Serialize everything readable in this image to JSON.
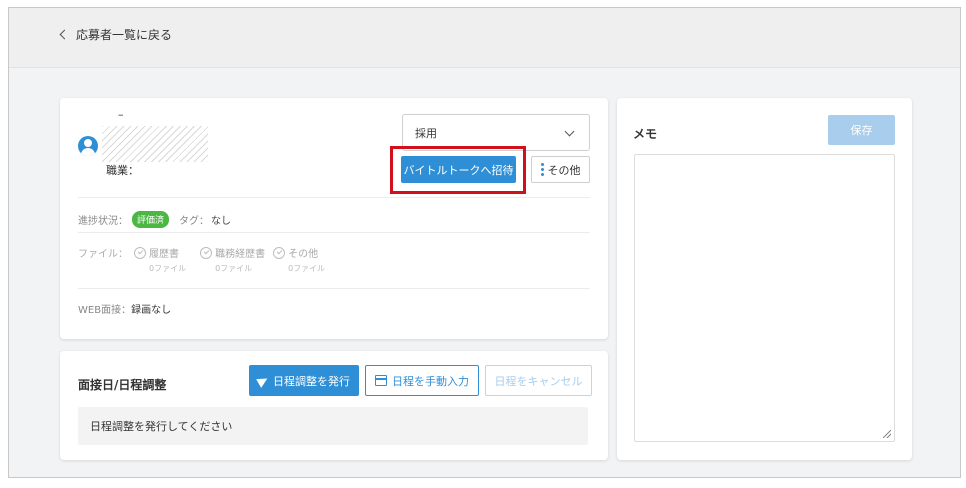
{
  "header": {
    "back_label": "応募者一覧に戻る"
  },
  "applicant": {
    "name_placeholder": "–",
    "job_label": "職業：",
    "status_select": "採用",
    "invite_button": "バイトルトークへ招待",
    "other_button": "その他",
    "progress_label": "進捗状況：",
    "progress_badge": "評価済",
    "tag_label": "タグ：",
    "tag_value": "なし",
    "files_label": "ファイル：",
    "files": [
      {
        "name": "履歴書",
        "count": "0ファイル"
      },
      {
        "name": "職務経歴書",
        "count": "0ファイル"
      },
      {
        "name": "その他",
        "count": "0ファイル"
      }
    ],
    "web_interview_label": "WEB面接：",
    "web_interview_value": "録画なし"
  },
  "schedule": {
    "title": "面接日/日程調整",
    "issue_button": "日程調整を発行",
    "manual_button": "日程を手動入力",
    "cancel_button": "日程をキャンセル",
    "message": "日程調整を発行してください"
  },
  "memo": {
    "title": "メモ",
    "save_button": "保存",
    "content": ""
  },
  "colors": {
    "primary": "#2f8fd6",
    "badge": "#4bb843",
    "highlight": "#d0101b",
    "disabled": "#a9cdec"
  }
}
